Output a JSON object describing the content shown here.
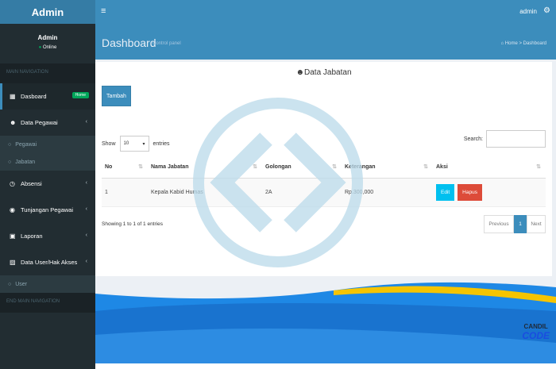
{
  "app": {
    "logo": "Admin",
    "toggle_icon": "hamburger-icon"
  },
  "topbar": {
    "user": "admin",
    "settings_icon": "gear-icon"
  },
  "sidebar": {
    "user_name": "Admin",
    "status": "Online",
    "main_header": "MAIN NAVIGATION",
    "end_header": "END MAIN NAVIGATION",
    "items": [
      {
        "label": "Dasboard",
        "icon": "grid-icon",
        "badge": "Home"
      },
      {
        "label": "Data Pegawai",
        "icon": "users-icon",
        "sub": [
          "Pegawai",
          "Jabatan"
        ]
      },
      {
        "label": "Absensi",
        "icon": "clock-icon"
      },
      {
        "label": "Tunjangan Pegawai",
        "icon": "money-icon"
      },
      {
        "label": "Laporan",
        "icon": "report-icon"
      },
      {
        "label": "Data User/Hak Akses",
        "icon": "lock-icon",
        "sub": [
          "User"
        ]
      }
    ]
  },
  "header": {
    "title": "Dashboard",
    "subtitle": "Control panel",
    "breadcrumb_home": "Home",
    "breadcrumb_current": "Dashboard"
  },
  "box": {
    "title": "Data Jabatan",
    "add_button": "Tambah",
    "show_label": "Show",
    "entries_value": "10",
    "entries_label": "entries",
    "search_label": "Search:",
    "columns": [
      "No",
      "Nama Jabatan",
      "Golongan",
      "Keterangan",
      "Aksi"
    ],
    "rows": [
      {
        "no": "1",
        "nama": "Kepala Kabid Humas",
        "golongan": "2A",
        "keterangan": "Rp.300,000",
        "edit": "Edit",
        "hapus": "Hapus"
      }
    ],
    "info": "Showing 1 to 1 of 1 entries",
    "pager": {
      "prev": "Previous",
      "page": "1",
      "next": "Next"
    }
  },
  "brand": {
    "line1": "CANDIL",
    "line2": "CODE"
  },
  "colors": {
    "primary": "#3c8dbc",
    "sidebar": "#222d32",
    "success": "#00a65a",
    "info": "#00c0ef",
    "danger": "#dd4b39"
  }
}
